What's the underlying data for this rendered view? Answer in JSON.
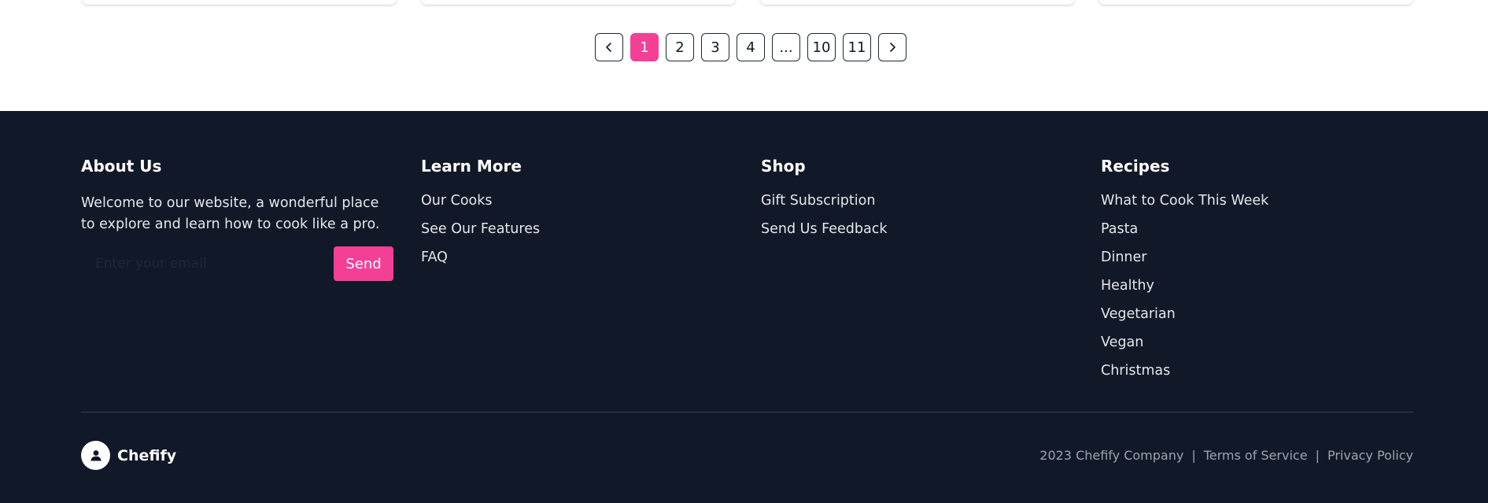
{
  "pagination": {
    "prev_icon": "chevron-left-icon",
    "next_icon": "chevron-right-icon",
    "pages": [
      "1",
      "2",
      "3",
      "4",
      "...",
      "10",
      "11"
    ],
    "current": "1"
  },
  "footer": {
    "about": {
      "title": "About Us",
      "text": "Welcome to our website, a wonderful place to explore and learn how to cook like a pro.",
      "email_placeholder": "Enter your email",
      "send_label": "Send"
    },
    "learn_more": {
      "title": "Learn More",
      "links": [
        "Our Cooks",
        "See Our Features",
        "FAQ"
      ]
    },
    "shop": {
      "title": "Shop",
      "links": [
        "Gift Subscription",
        "Send Us Feedback"
      ]
    },
    "recipes": {
      "title": "Recipes",
      "links": [
        "What to Cook This Week",
        "Pasta",
        "Dinner",
        "Healthy",
        "Vegetarian",
        "Vegan",
        "Christmas"
      ]
    },
    "brand": {
      "name": "Chefify",
      "logo_icon": "chef-user-icon"
    },
    "legal": {
      "copyright": "2023 Chefify Company",
      "separator": "|",
      "terms": "Terms of Service",
      "privacy": "Privacy Policy"
    }
  },
  "colors": {
    "accent": "#f43f97",
    "footer_bg": "#111827",
    "divider": "#374151",
    "muted_text": "#9ca3af"
  }
}
